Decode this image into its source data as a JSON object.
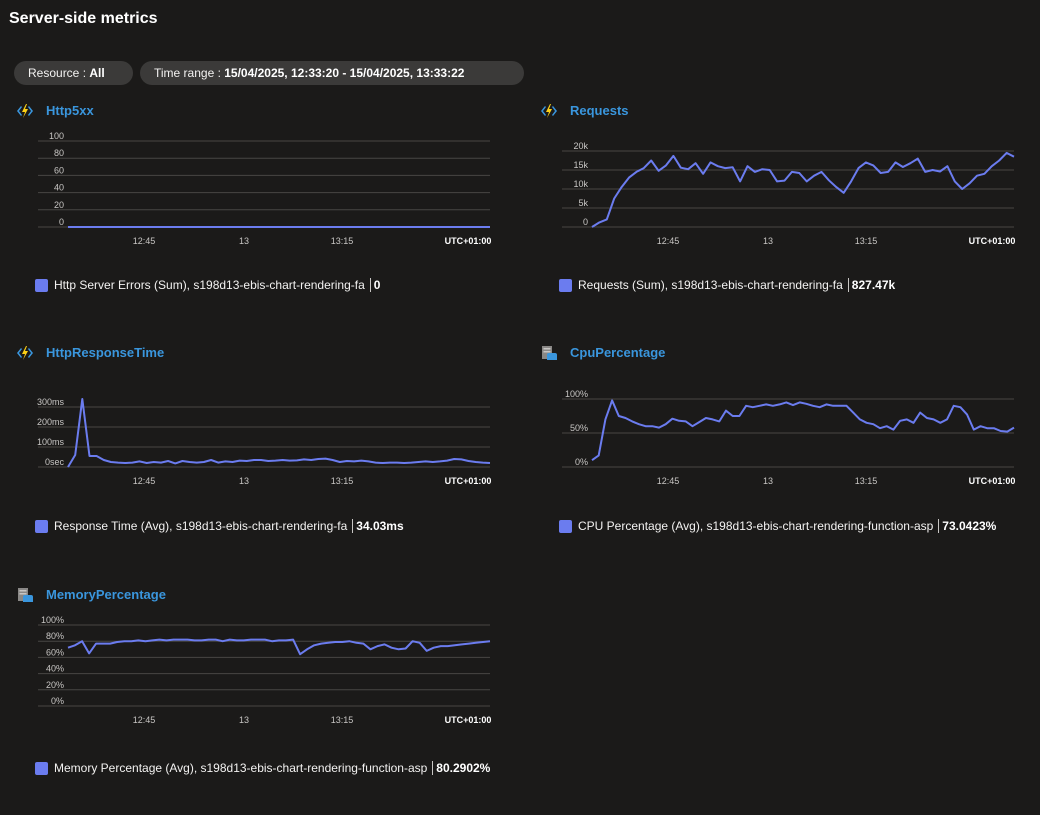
{
  "page": {
    "title": "Server-side metrics"
  },
  "filters": {
    "resource_label": "Resource : ",
    "resource_value": "All",
    "time_label": "Time range : ",
    "time_value": "15/04/2025, 12:33:20 - 15/04/2025, 13:33:22"
  },
  "colors": {
    "series": "#6b7cef",
    "title": "#3a96dd",
    "grid": "#484644",
    "background": "#1b1a19"
  },
  "tiles": [
    {
      "title": "Http5xx",
      "icon": "function-app-icon",
      "legend": {
        "label": "Http Server Errors (Sum), s198d13-ebis-chart-rendering-fa",
        "value": "0"
      },
      "chart_data": {
        "type": "line",
        "title": "Http5xx",
        "yticks": [
          "100",
          "80",
          "60",
          "40",
          "20",
          "0"
        ],
        "ylim": [
          0,
          100
        ],
        "xticks": [
          "12:45",
          "13",
          "13:15"
        ],
        "timezone": "UTC+01:00",
        "grid": true,
        "series": [
          {
            "name": "Http Server Errors (Sum), s198d13-ebis-chart-rendering-fa",
            "values": [
              0,
              0,
              0,
              0,
              0,
              0,
              0,
              0,
              0,
              0,
              0,
              0,
              0,
              0,
              0,
              0,
              0,
              0,
              0,
              0,
              0,
              0,
              0,
              0,
              0,
              0,
              0,
              0,
              0,
              0,
              0,
              0,
              0,
              0,
              0,
              0,
              0,
              0,
              0,
              0,
              0,
              0,
              0,
              0,
              0,
              0,
              0,
              0,
              0,
              0,
              0,
              0,
              0,
              0,
              0,
              0,
              0,
              0,
              0,
              0,
              0
            ]
          }
        ]
      }
    },
    {
      "title": "Requests",
      "icon": "function-app-icon",
      "legend": {
        "label": "Requests (Sum), s198d13-ebis-chart-rendering-fa",
        "value": "827.47k"
      },
      "chart_data": {
        "type": "line",
        "title": "Requests",
        "yticks": [
          "20k",
          "15k",
          "10k",
          "5k",
          "0"
        ],
        "ylim": [
          0,
          20000
        ],
        "xticks": [
          "12:45",
          "13",
          "13:15"
        ],
        "timezone": "UTC+01:00",
        "grid": true,
        "series": [
          {
            "name": "Requests (Sum), s198d13-ebis-chart-rendering-fa",
            "values": [
              0,
              1200,
              2000,
              7500,
              10500,
              13000,
              14500,
              15500,
              17500,
              14800,
              16200,
              18700,
              15600,
              15200,
              16800,
              14000,
              17000,
              16000,
              15500,
              15700,
              12000,
              16000,
              14500,
              15200,
              15000,
              12000,
              12200,
              14500,
              14200,
              12000,
              13500,
              14500,
              12300,
              10500,
              9000,
              12000,
              15500,
              17000,
              16200,
              14200,
              14500,
              17000,
              15800,
              16800,
              18000,
              14500,
              15000,
              14600,
              16000,
              12000,
              10000,
              11500,
              13500,
              14000,
              16000,
              17500,
              19500,
              18500
            ]
          }
        ]
      }
    },
    {
      "title": "HttpResponseTime",
      "icon": "function-app-icon",
      "legend": {
        "label": "Response Time (Avg), s198d13-ebis-chart-rendering-fa",
        "value": "34.03ms"
      },
      "chart_data": {
        "type": "line",
        "title": "HttpResponseTime",
        "yticks": [
          "300ms",
          "200ms",
          "100ms",
          "0sec"
        ],
        "ylim": [
          0,
          300
        ],
        "xticks": [
          "12:45",
          "13",
          "13:15"
        ],
        "timezone": "UTC+01:00",
        "grid": true,
        "series": [
          {
            "name": "Response Time (Avg), s198d13-ebis-chart-rendering-fa",
            "values": [
              0,
              60,
              340,
              55,
              55,
              35,
              25,
              22,
              20,
              22,
              28,
              20,
              25,
              22,
              30,
              18,
              30,
              25,
              22,
              25,
              35,
              22,
              28,
              25,
              32,
              30,
              35,
              35,
              30,
              32,
              35,
              32,
              33,
              38,
              35,
              40,
              42,
              35,
              25,
              30,
              28,
              32,
              28,
              22,
              20,
              22,
              22,
              20,
              22,
              25,
              28,
              25,
              28,
              32,
              40,
              38,
              30,
              25,
              22,
              20
            ]
          }
        ]
      }
    },
    {
      "title": "CpuPercentage",
      "icon": "app-service-plan-icon",
      "legend": {
        "label": "CPU Percentage (Avg), s198d13-ebis-chart-rendering-function-asp",
        "value": "73.0423%"
      },
      "chart_data": {
        "type": "line",
        "title": "CpuPercentage",
        "yticks": [
          "100%",
          "50%",
          "0%"
        ],
        "ylim": [
          0,
          100
        ],
        "xticks": [
          "12:45",
          "13",
          "13:15"
        ],
        "timezone": "UTC+01:00",
        "grid": true,
        "series": [
          {
            "name": "CPU Percentage (Avg), s198d13-ebis-chart-rendering-function-asp",
            "values": [
              10,
              17,
              70,
              98,
              75,
              72,
              67,
              63,
              60,
              60,
              58,
              63,
              71,
              68,
              67,
              60,
              66,
              72,
              70,
              67,
              83,
              75,
              75,
              90,
              88,
              90,
              92,
              90,
              92,
              95,
              91,
              95,
              93,
              90,
              88,
              92,
              90,
              90,
              90,
              80,
              70,
              65,
              63,
              57,
              60,
              55,
              68,
              70,
              65,
              80,
              72,
              70,
              65,
              70,
              90,
              88,
              77,
              55,
              60,
              57,
              57,
              53,
              52,
              58
            ]
          }
        ]
      }
    },
    {
      "title": "MemoryPercentage",
      "icon": "app-service-plan-icon",
      "legend": {
        "label": "Memory Percentage (Avg), s198d13-ebis-chart-rendering-function-asp",
        "value": "80.2902%"
      },
      "chart_data": {
        "type": "line",
        "title": "MemoryPercentage",
        "yticks": [
          "100%",
          "80%",
          "60%",
          "40%",
          "20%",
          "0%"
        ],
        "ylim": [
          0,
          100
        ],
        "xticks": [
          "12:45",
          "13",
          "13:15"
        ],
        "timezone": "UTC+01:00",
        "grid": true,
        "series": [
          {
            "name": "Memory Percentage (Avg), s198d13-ebis-chart-rendering-function-asp",
            "values": [
              72,
              75,
              80,
              65,
              77,
              77,
              77,
              79,
              80,
              80,
              81,
              80,
              81,
              82,
              81,
              82,
              82,
              82,
              81,
              81,
              82,
              82,
              80,
              82,
              81,
              81,
              82,
              82,
              82,
              80,
              81,
              81,
              82,
              64,
              70,
              75,
              77,
              78,
              79,
              79,
              80,
              78,
              77,
              70,
              74,
              76,
              72,
              70,
              71,
              80,
              78,
              68,
              72,
              74,
              74,
              75,
              76,
              77,
              78,
              79,
              80
            ]
          }
        ]
      }
    }
  ]
}
